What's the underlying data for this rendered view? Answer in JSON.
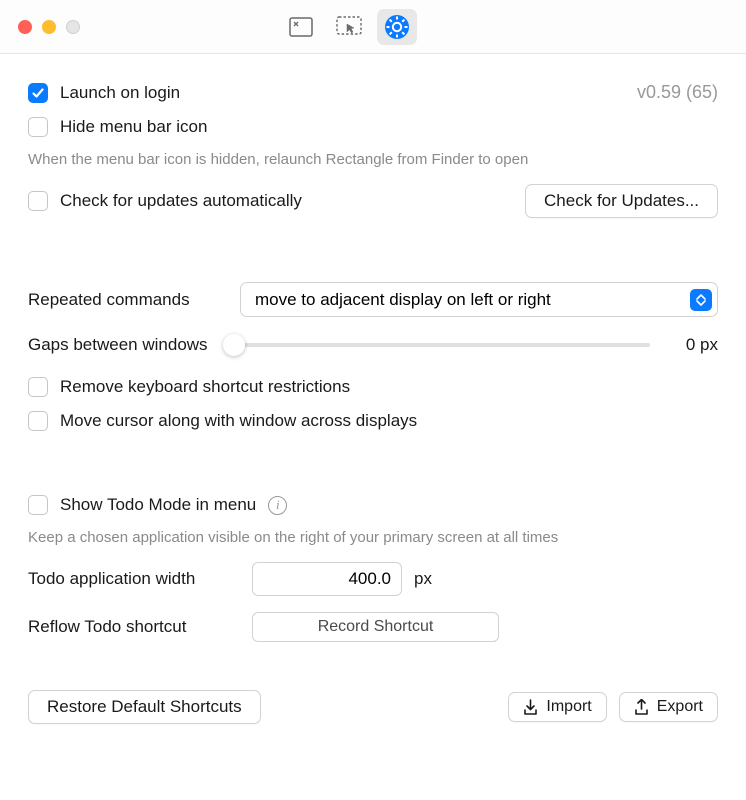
{
  "toolbar": {
    "tabs": [
      "window-layout-icon",
      "cursor-icon",
      "gear-icon"
    ],
    "active_index": 2
  },
  "version": "v0.59 (65)",
  "checks": {
    "launch_on_login": {
      "label": "Launch on login",
      "checked": true
    },
    "hide_menubar": {
      "label": "Hide menu bar icon",
      "checked": false
    },
    "check_updates_auto": {
      "label": "Check for updates automatically",
      "checked": false
    },
    "remove_shortcut_restrictions": {
      "label": "Remove keyboard shortcut restrictions",
      "checked": false
    },
    "move_cursor": {
      "label": "Move cursor along with window across displays",
      "checked": false
    },
    "show_todo": {
      "label": "Show Todo Mode in menu",
      "checked": false
    }
  },
  "hints": {
    "hide_menubar": "When the menu bar icon is hidden, relaunch Rectangle from Finder to open",
    "todo": "Keep a chosen application visible on the right of your primary screen at all times"
  },
  "buttons": {
    "check_updates": "Check for Updates...",
    "restore_defaults": "Restore Default Shortcuts",
    "import": "Import",
    "export": "Export",
    "record_shortcut": "Record Shortcut"
  },
  "repeated": {
    "label": "Repeated commands",
    "selected": "move to adjacent display on left or right"
  },
  "gaps": {
    "label": "Gaps between windows",
    "value": "0 px"
  },
  "todo_width": {
    "label": "Todo application width",
    "value": "400.0",
    "unit": "px"
  },
  "reflow": {
    "label": "Reflow Todo shortcut"
  }
}
